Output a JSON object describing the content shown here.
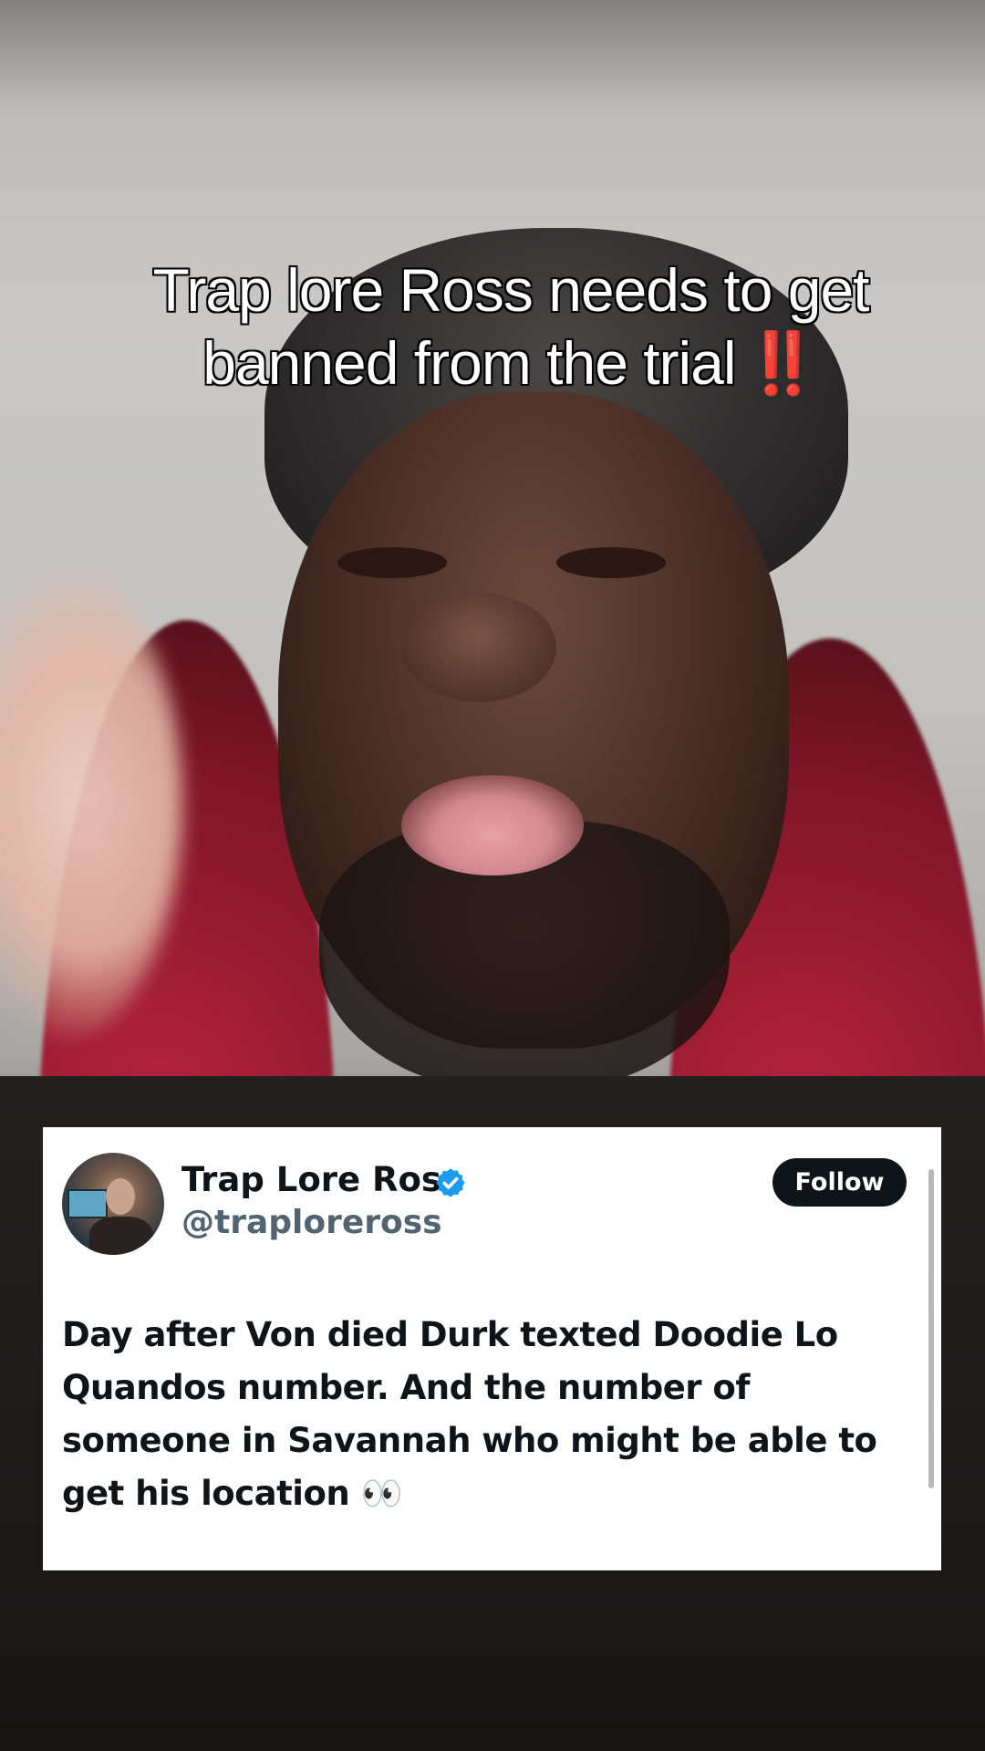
{
  "overlay": {
    "caption": "Trap lore Ross needs to get banned from the trial",
    "caption_emoji": "‼️"
  },
  "tweet": {
    "display_name": "Trap Lore Ross",
    "handle": "@traploreross",
    "verified": true,
    "follow_label": "Follow",
    "text": "Day after Von died Durk texted Doodie Lo Quandos number. And the number of someone in Savannah who might be able to get his location 👀"
  },
  "colors": {
    "card_bg": "#ffffff",
    "text_primary": "#0f1419",
    "text_secondary": "#536471",
    "verified_blue": "#1d9bf0",
    "follow_bg": "#0f1419",
    "caption_alert": "#e2141c"
  },
  "icons": {
    "verified": "verified-badge-icon"
  }
}
